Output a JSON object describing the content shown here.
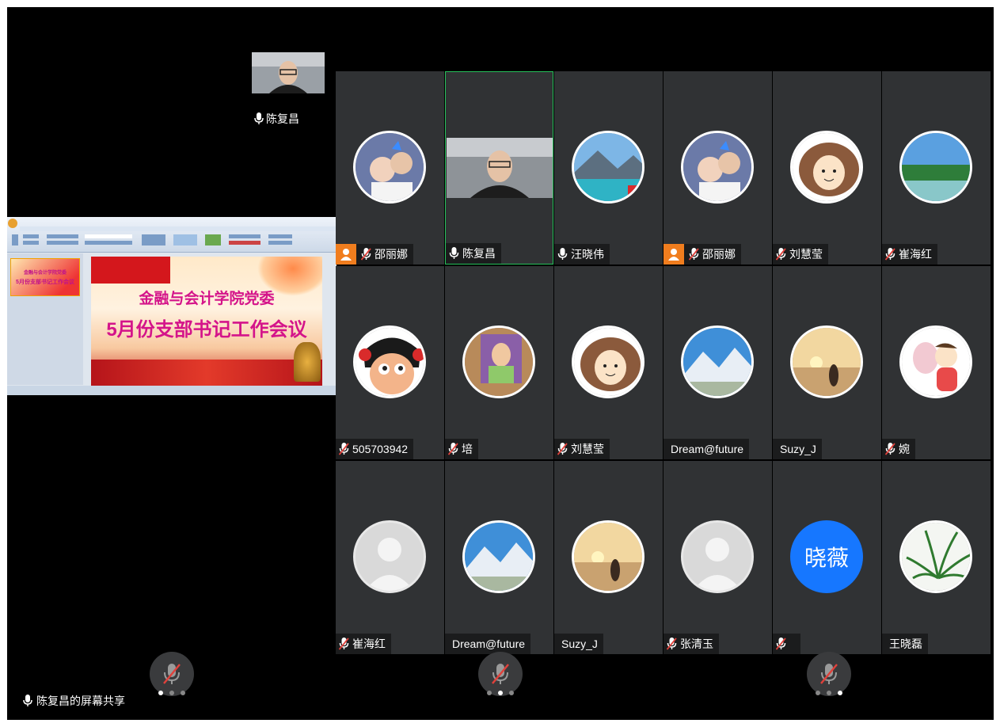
{
  "speaker": {
    "name": "陈复昌"
  },
  "screen_share": {
    "label": "陈复昌的屏幕共享",
    "slide_line1": "金融与会计学院党委",
    "slide_line2": "5月份支部书记工作会议"
  },
  "participants": [
    {
      "name": "邵丽娜",
      "mic": "muted",
      "hand": true,
      "avatar": "photo-kids"
    },
    {
      "name": "陈复昌",
      "mic": "on",
      "hand": false,
      "avatar": "video",
      "active": true
    },
    {
      "name": "汪晓伟",
      "mic": "on",
      "hand": false,
      "avatar": "photo-lake"
    },
    {
      "name": "邵丽娜",
      "mic": "muted",
      "hand": true,
      "avatar": "photo-kids"
    },
    {
      "name": "刘慧莹",
      "mic": "muted",
      "hand": false,
      "avatar": "cartoon-girl"
    },
    {
      "name": "崔海红",
      "mic": "muted",
      "hand": false,
      "avatar": "photo-park"
    },
    {
      "name": "505703942",
      "mic": "muted",
      "hand": false,
      "avatar": "cartoon-face"
    },
    {
      "name": "培",
      "mic": "muted",
      "hand": false,
      "avatar": "painting"
    },
    {
      "name": "刘慧莹",
      "mic": "muted",
      "hand": false,
      "avatar": "cartoon-girl"
    },
    {
      "name": "Dream@future",
      "mic": "none",
      "hand": false,
      "avatar": "photo-mountain"
    },
    {
      "name": "Suzy_J",
      "mic": "none",
      "hand": false,
      "avatar": "photo-sunset"
    },
    {
      "name": "婉",
      "mic": "muted",
      "hand": false,
      "avatar": "cartoon-baby"
    },
    {
      "name": "崔海红",
      "mic": "muted",
      "hand": false,
      "avatar": "default"
    },
    {
      "name": "Dream@future",
      "mic": "none",
      "hand": false,
      "avatar": "photo-mountain"
    },
    {
      "name": "Suzy_J",
      "mic": "none",
      "hand": false,
      "avatar": "photo-sunset"
    },
    {
      "name": "张清玉",
      "mic": "muted",
      "hand": false,
      "avatar": "default"
    },
    {
      "name": "",
      "mic": "muted",
      "hand": false,
      "avatar": "text",
      "avatar_text": "晓薇"
    },
    {
      "name": "王晓磊",
      "mic": "none",
      "hand": false,
      "avatar": "photo-plant"
    }
  ],
  "pager": {
    "pages": 3,
    "current": [
      0,
      1,
      2
    ]
  },
  "colors": {
    "active_border": "#27c15b",
    "hand_raise": "#f07d1e",
    "text_avatar": "#1677ff",
    "muted_slash": "#e0413b"
  }
}
